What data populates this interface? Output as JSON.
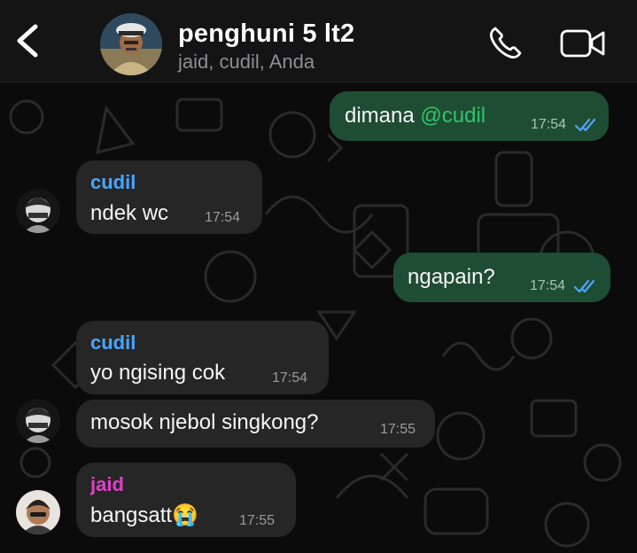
{
  "header": {
    "title": "penghuni 5 lt2",
    "subtitle": "jaid, cudil, Anda"
  },
  "messages": [
    {
      "direction": "out",
      "text": "dimana ",
      "mention": "@cudil",
      "time": "17:54",
      "read": true
    },
    {
      "direction": "in",
      "sender": "cudil",
      "text": "ndek wc",
      "time": "17:54"
    },
    {
      "direction": "out",
      "text": "ngapain?",
      "time": "17:54",
      "read": true
    },
    {
      "direction": "in",
      "sender": "cudil",
      "text": "yo ngising cok",
      "time": "17:54"
    },
    {
      "direction": "in",
      "text": "mosok njebol singkong?",
      "time": "17:55"
    },
    {
      "direction": "in",
      "sender": "jaid",
      "text": "bangsatt",
      "emoji": "😭",
      "time": "17:55"
    }
  ],
  "icons": {
    "back": "chevron-left-icon",
    "call": "phone-icon",
    "video": "video-camera-icon",
    "read_receipt": "double-check-icon"
  },
  "colors": {
    "header_bg": "#141414",
    "outgoing_bubble": "#1f4d34",
    "incoming_bubble": "#262626",
    "mention": "#31c46b",
    "sender_cudil": "#4aa5ff",
    "sender_jaid": "#e040c9",
    "read_ticks": "#4fa3ff"
  }
}
